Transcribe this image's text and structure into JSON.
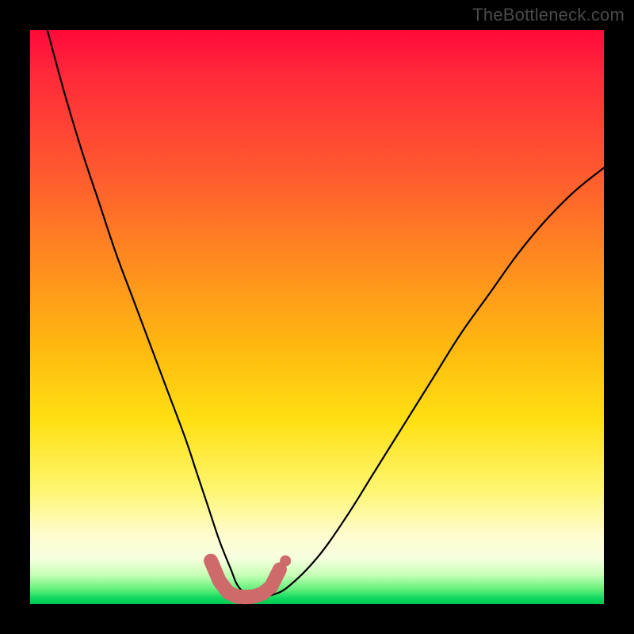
{
  "watermark": "TheBottleneck.com",
  "chart_data": {
    "type": "line",
    "title": "",
    "xlabel": "",
    "ylabel": "",
    "xlim": [
      0,
      100
    ],
    "ylim": [
      0,
      100
    ],
    "series": [
      {
        "name": "bottleneck-curve",
        "x": [
          3,
          6,
          9,
          12,
          15,
          18,
          21,
          24,
          27,
          29,
          31,
          33,
          35,
          36,
          37,
          38,
          40,
          42,
          45,
          50,
          55,
          60,
          65,
          70,
          75,
          80,
          85,
          90,
          95,
          100
        ],
        "y": [
          100,
          89,
          79,
          70,
          61,
          53,
          45,
          37,
          29,
          23,
          17,
          11,
          6,
          3.5,
          2.2,
          1.5,
          1.2,
          1.5,
          3,
          8,
          15,
          23,
          31,
          39,
          47,
          54,
          61,
          67,
          72,
          76
        ]
      }
    ],
    "valley_marker": {
      "name": "optimal-range",
      "color": "#cf6a6a",
      "x": [
        31.5,
        33,
        34.5,
        36,
        37.5,
        39,
        40.5,
        42,
        43.5
      ],
      "y": [
        7.5,
        4.0,
        2.0,
        1.3,
        1.2,
        1.3,
        1.8,
        3.0,
        6.0
      ]
    }
  }
}
